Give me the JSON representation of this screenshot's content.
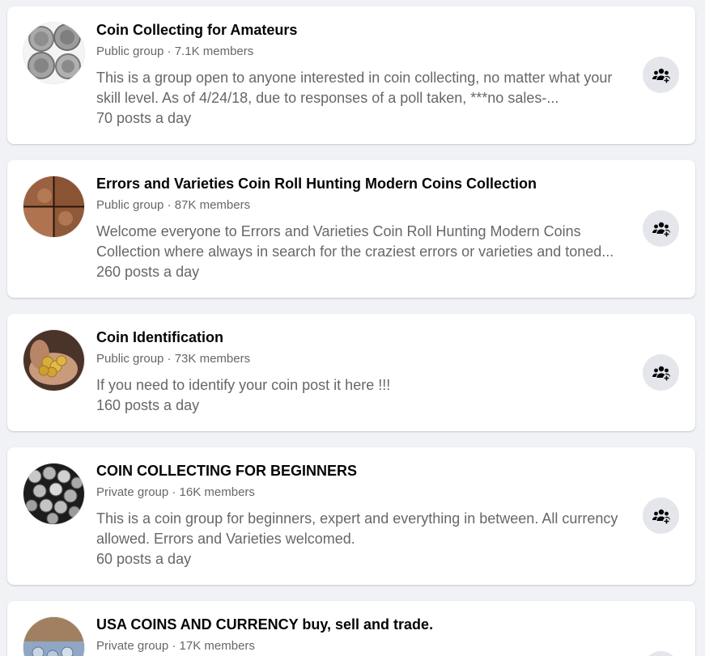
{
  "groups": [
    {
      "name": "Coin Collecting for Amateurs",
      "meta": "Public group · 7.1K members",
      "description": "This is a group open to anyone interested in coin collecting, no matter what your skill level. As of 4/24/18, due to responses of a poll taken, ***no sales-...",
      "activity": "70 posts a day",
      "avatar_icon": "coins-photo",
      "join_icon": "group-add-icon"
    },
    {
      "name": "Errors and Varieties Coin Roll Hunting Modern Coins Collection",
      "meta": "Public group · 87K members",
      "description": "Welcome everyone to Errors and Varieties Coin Roll Hunting Modern Coins Collection where always in search for the craziest errors or varieties and toned...",
      "activity": "260 posts a day",
      "avatar_icon": "penny-dates-photo",
      "join_icon": "group-add-icon"
    },
    {
      "name": "Coin Identification",
      "meta": "Public group · 73K members",
      "description": "If you need to identify your coin post it here !!!",
      "activity": "160 posts a day",
      "avatar_icon": "gold-coins-hand-photo",
      "join_icon": "group-add-icon"
    },
    {
      "name": "COIN COLLECTING FOR BEGINNERS",
      "meta": "Private group · 16K members",
      "description": "This is a coin group for beginners, expert and everything in between. All currency allowed. Errors and Varieties welcomed.",
      "activity": "60 posts a day",
      "avatar_icon": "coin-pile-photo",
      "join_icon": "group-add-icon"
    },
    {
      "name": "USA COINS AND CURRENCY buy, sell and trade.",
      "meta": "Private group · 17K members",
      "description": "",
      "activity": "",
      "avatar_icon": "coins-currency-photo",
      "join_icon": "group-add-icon"
    }
  ],
  "colors": {
    "background": "#f0f2f5",
    "card": "#ffffff",
    "title": "#050505",
    "secondary_text": "#65676b",
    "button_bg": "#e4e6eb",
    "icon": "#050505"
  }
}
